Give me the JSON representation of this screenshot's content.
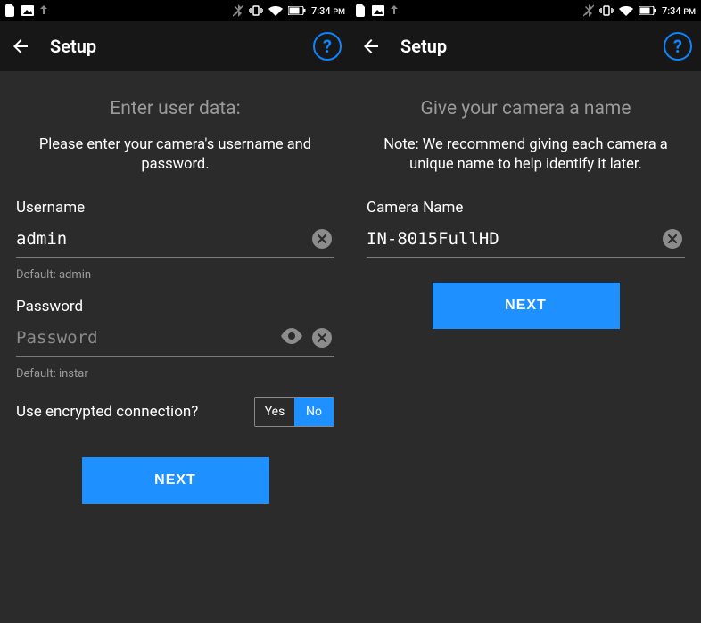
{
  "statusbar": {
    "time": "7:34",
    "ampm": "PM"
  },
  "left": {
    "appbar": {
      "title": "Setup"
    },
    "heading": "Enter user data:",
    "subtext": "Please enter your camera's username and password.",
    "username": {
      "label": "Username",
      "value": "admin",
      "hint": "Default: admin"
    },
    "password": {
      "label": "Password",
      "placeholder": "Password",
      "value": "",
      "hint": "Default: instar"
    },
    "encrypted": {
      "label": "Use encrypted connection?",
      "yes": "Yes",
      "no": "No",
      "active": "no"
    },
    "next": "NEXT"
  },
  "right": {
    "appbar": {
      "title": "Setup"
    },
    "heading": "Give your camera a name",
    "subtext": "Note: We recommend giving each camera a unique name to help identify it later.",
    "camera": {
      "label": "Camera Name",
      "value": "IN-8015FullHD"
    },
    "next": "NEXT"
  }
}
